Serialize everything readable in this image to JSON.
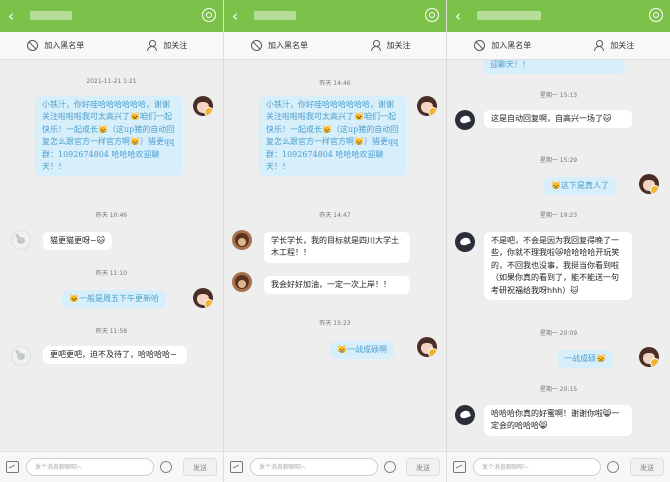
{
  "common": {
    "back_icon": "‹",
    "blacklist_label": "加入黑名单",
    "follow_label": "加关注",
    "input_placeholder": "发个消息聊聊呗~",
    "send_label": "发送",
    "icons": [
      "back-arrow-icon",
      "gear-icon",
      "ban-icon",
      "add-user-icon",
      "image-icon",
      "smile-icon"
    ],
    "colors": {
      "header": "#7cc24a",
      "bubble_out": "#d7eefb",
      "bubble_out_text": "#4aa0cd",
      "bubble_in": "#ffffff"
    }
  },
  "screen1": {
    "ts1": "2021-11-21 1:21",
    "m1": "小铁汁，你好哇哈哈哈哈哈哈，谢谢关注啦啦啦我可太高兴了🐱咱们一起快乐！一起成长😸（这up猪的自动回复怎么跟官方一样官方啊😸）猎更qq群：1092674804 哈哈哈欢迎聊天！！",
    "ts2": "昨天 10:46",
    "m2": "猫更猫更呀~🐱",
    "ts3": "昨天 11:10",
    "m3": "🐱一般是周五下午更新哈",
    "ts4": "昨天 11:58",
    "m4": "更吧更吧，迫不及待了，哈哈哈哈~"
  },
  "screen2": {
    "ts1": "昨天 14:46",
    "m1": "小铁汁，你好哇哈哈哈哈哈哈，谢谢关注啦啦啦我可太高兴了🐱咱们一起快乐！一起成长😸（这up猪的自动回复怎么跟官方一样官方啊😸）猎更qq群：1092674804 哈哈哈欢迎聊天！！",
    "ts2": "昨天 14:47",
    "m2": "学长学长，我的目标就是四川大学土木工程！！",
    "m3": "我会好好加油，一定一次上岸！！",
    "ts3": "昨天 15:23",
    "m4": "😸一战成硕啊"
  },
  "screen3": {
    "m0": "迎聊天！！",
    "ts1": "星期一 15:13",
    "m1": "这是自动回复啊，自高兴一场了🐱",
    "ts2": "星期一 15:29",
    "m2": "😸这下是真人了",
    "ts3": "星期一 19:23",
    "m3": "不是吧，不会是因为我回复得晚了一些，你就不理我啦😿哈哈哈哈开玩笑的，不回我也没事，我挺当你看到啦（如果你真的看到了，能不能送一句考研祝福给我呀hhh）🐱",
    "ts4": "星期一 20:09",
    "m4": "一战成硕😸",
    "ts5": "星期一 20:15",
    "m5": "哈哈哈你真的好蜜啊！谢谢你啦😸一定会的哈哈哈😸"
  }
}
